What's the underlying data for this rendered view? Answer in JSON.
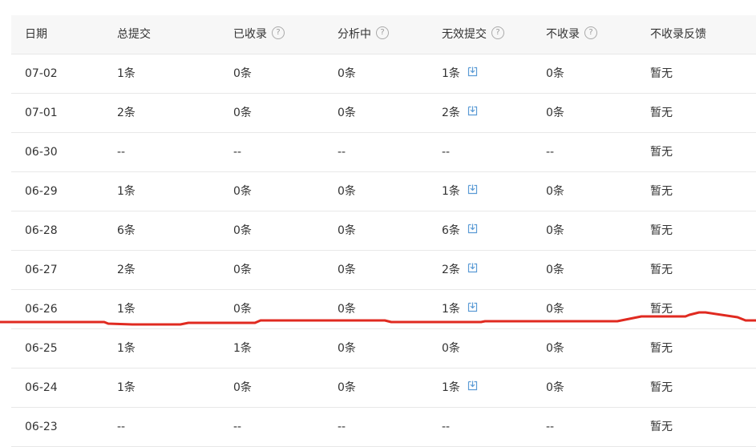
{
  "table": {
    "headers": [
      {
        "label": "日期",
        "help": false
      },
      {
        "label": "总提交",
        "help": false
      },
      {
        "label": "已收录",
        "help": true
      },
      {
        "label": "分析中",
        "help": true
      },
      {
        "label": "无效提交",
        "help": true
      },
      {
        "label": "不收录",
        "help": true
      },
      {
        "label": "不收录反馈",
        "help": false
      }
    ],
    "help_glyph": "?",
    "rows": [
      {
        "date": "07-02",
        "total": "1条",
        "indexed": "0条",
        "analyzing": "0条",
        "invalid": "1条",
        "invalid_download": true,
        "not_indexed": "0条",
        "feedback": "暂无"
      },
      {
        "date": "07-01",
        "total": "2条",
        "indexed": "0条",
        "analyzing": "0条",
        "invalid": "2条",
        "invalid_download": true,
        "not_indexed": "0条",
        "feedback": "暂无"
      },
      {
        "date": "06-30",
        "total": "--",
        "indexed": "--",
        "analyzing": "--",
        "invalid": "--",
        "invalid_download": false,
        "not_indexed": "--",
        "feedback": "暂无"
      },
      {
        "date": "06-29",
        "total": "1条",
        "indexed": "0条",
        "analyzing": "0条",
        "invalid": "1条",
        "invalid_download": true,
        "not_indexed": "0条",
        "feedback": "暂无"
      },
      {
        "date": "06-28",
        "total": "6条",
        "indexed": "0条",
        "analyzing": "0条",
        "invalid": "6条",
        "invalid_download": true,
        "not_indexed": "0条",
        "feedback": "暂无"
      },
      {
        "date": "06-27",
        "total": "2条",
        "indexed": "0条",
        "analyzing": "0条",
        "invalid": "2条",
        "invalid_download": true,
        "not_indexed": "0条",
        "feedback": "暂无"
      },
      {
        "date": "06-26",
        "total": "1条",
        "indexed": "0条",
        "analyzing": "0条",
        "invalid": "1条",
        "invalid_download": true,
        "not_indexed": "0条",
        "feedback": "暂无"
      },
      {
        "date": "06-25",
        "total": "1条",
        "indexed": "1条",
        "analyzing": "0条",
        "invalid": "0条",
        "invalid_download": false,
        "not_indexed": "0条",
        "feedback": "暂无"
      },
      {
        "date": "06-24",
        "total": "1条",
        "indexed": "0条",
        "analyzing": "0条",
        "invalid": "1条",
        "invalid_download": true,
        "not_indexed": "0条",
        "feedback": "暂无"
      },
      {
        "date": "06-23",
        "total": "--",
        "indexed": "--",
        "analyzing": "--",
        "invalid": "--",
        "invalid_download": false,
        "not_indexed": "--",
        "feedback": "暂无"
      }
    ]
  },
  "colors": {
    "annotation_line": "#e02a20",
    "download_icon": "#5b9bd5"
  }
}
